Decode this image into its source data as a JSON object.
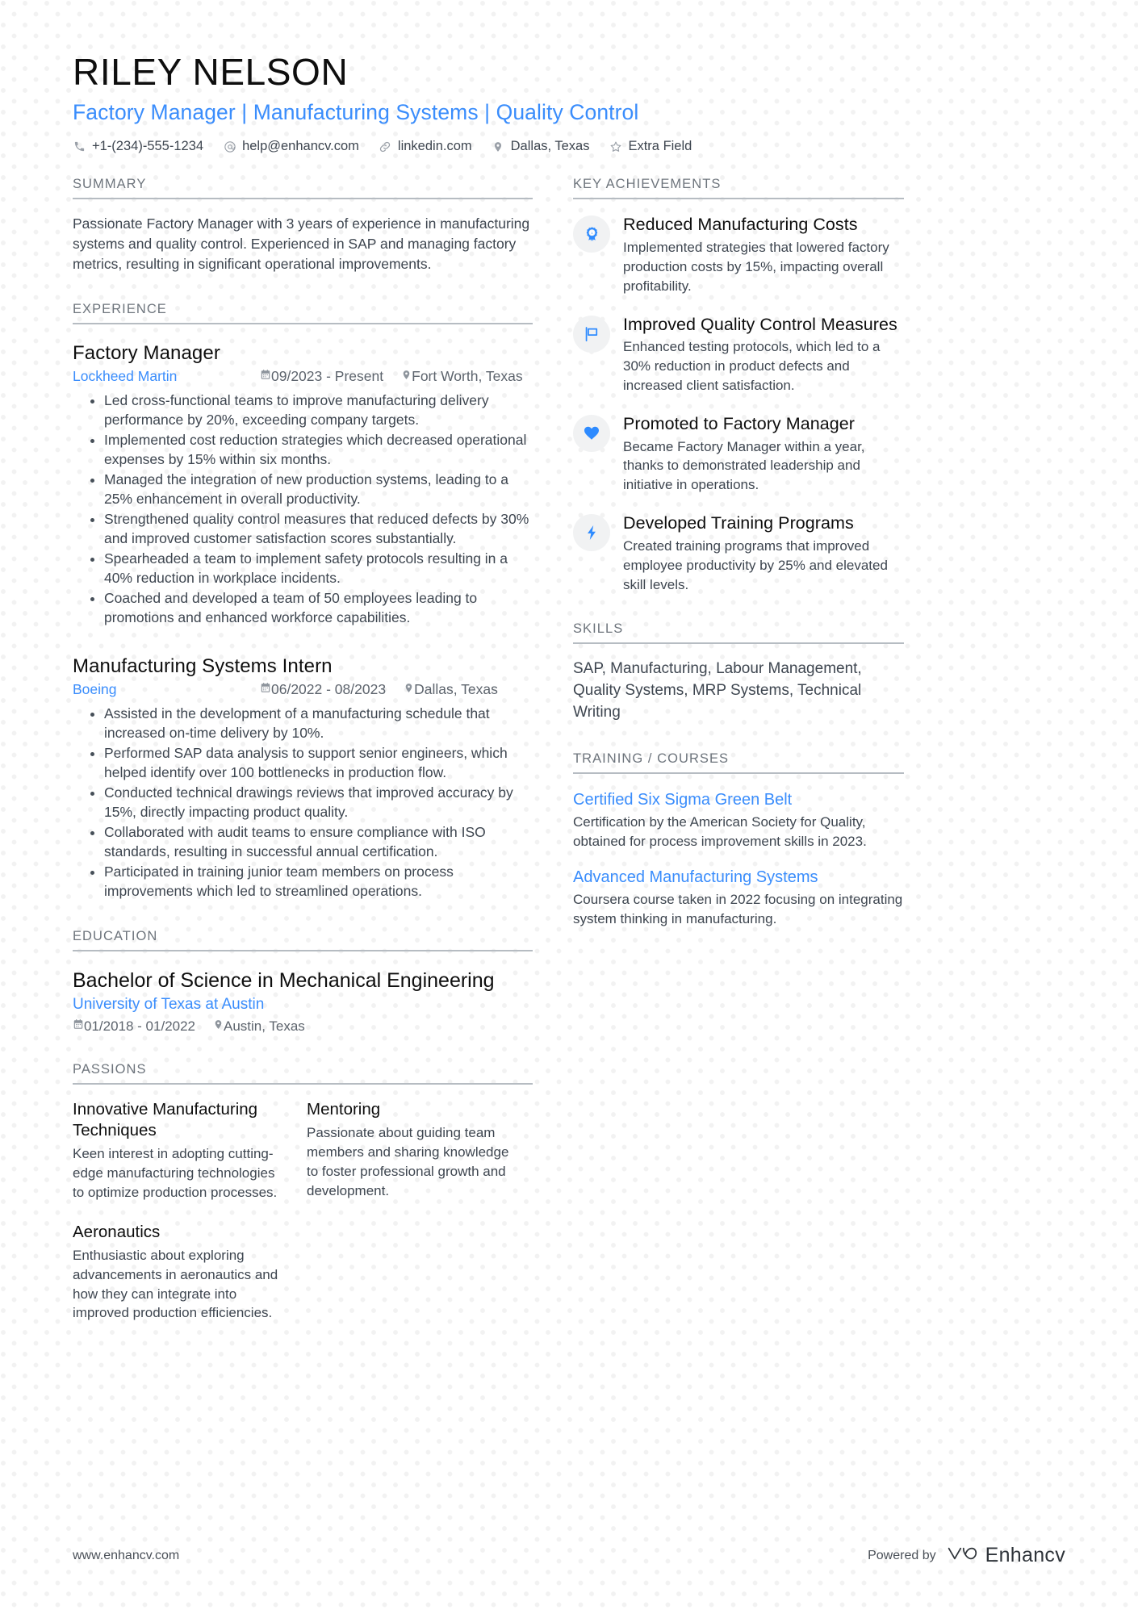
{
  "header": {
    "name": "RILEY NELSON",
    "headline": "Factory Manager | Manufacturing Systems | Quality Control",
    "contact": [
      {
        "icon": "phone-icon",
        "text": "+1-(234)-555-1234"
      },
      {
        "icon": "email-icon",
        "text": "help@enhancv.com"
      },
      {
        "icon": "link-icon",
        "text": "linkedin.com"
      },
      {
        "icon": "location-pin-icon",
        "text": "Dallas, Texas"
      },
      {
        "icon": "star-icon",
        "text": "Extra Field"
      }
    ]
  },
  "summary": {
    "title": "SUMMARY",
    "text": "Passionate Factory Manager with 3 years of experience in manufacturing systems and quality control. Experienced in SAP and managing factory metrics, resulting in significant operational improvements."
  },
  "experience": {
    "title": "EXPERIENCE",
    "jobs": [
      {
        "position": "Factory Manager",
        "company": "Lockheed Martin",
        "dates": "09/2023 - Present",
        "location": "Fort Worth, Texas",
        "bullets": [
          "Led cross-functional teams to improve manufacturing delivery performance by 20%, exceeding company targets.",
          "Implemented cost reduction strategies which decreased operational expenses by 15% within six months.",
          "Managed the integration of new production systems, leading to a 25% enhancement in overall productivity.",
          "Strengthened quality control measures that reduced defects by 30% and improved customer satisfaction scores substantially.",
          "Spearheaded a team to implement safety protocols resulting in a 40% reduction in workplace incidents.",
          "Coached and developed a team of 50 employees leading to promotions and enhanced workforce capabilities."
        ]
      },
      {
        "position": "Manufacturing Systems Intern",
        "company": "Boeing",
        "dates": "06/2022 - 08/2023",
        "location": "Dallas, Texas",
        "bullets": [
          "Assisted in the development of a manufacturing schedule that increased on-time delivery by 10%.",
          "Performed SAP data analysis to support senior engineers, which helped identify over 100 bottlenecks in production flow.",
          "Conducted technical drawings reviews that improved accuracy by 15%, directly impacting product quality.",
          "Collaborated with audit teams to ensure compliance with ISO standards, resulting in successful annual certification.",
          "Participated in training junior team members on process improvements which led to streamlined operations."
        ]
      }
    ]
  },
  "education": {
    "title": "EDUCATION",
    "entries": [
      {
        "degree": "Bachelor of Science in Mechanical Engineering",
        "school": "University of Texas at Austin",
        "dates": "01/2018 - 01/2022",
        "location": "Austin, Texas"
      }
    ]
  },
  "passions": {
    "title": "PASSIONS",
    "column_one": [
      {
        "name": "Innovative Manufacturing Techniques",
        "text": "Keen interest in adopting cutting-edge manufacturing technologies to optimize production processes."
      },
      {
        "name": "Aeronautics",
        "text": "Enthusiastic about exploring advancements in aeronautics and how they can integrate into improved production efficiencies."
      }
    ],
    "column_two": [
      {
        "name": "Mentoring",
        "text": "Passionate about guiding team members and sharing knowledge to foster professional growth and development."
      }
    ]
  },
  "achievements": {
    "title": "KEY ACHIEVEMENTS",
    "items": [
      {
        "icon": "award-medal-icon",
        "name": "Reduced Manufacturing Costs",
        "text": "Implemented strategies that lowered factory production costs by 15%, impacting overall profitability."
      },
      {
        "icon": "flag-icon",
        "name": "Improved Quality Control Measures",
        "text": "Enhanced testing protocols, which led to a 30% reduction in product defects and increased client satisfaction."
      },
      {
        "icon": "heart-icon",
        "name": "Promoted to Factory Manager",
        "text": "Became Factory Manager within a year, thanks to demonstrated leadership and initiative in operations."
      },
      {
        "icon": "lightning-bolt-icon",
        "name": "Developed Training Programs",
        "text": "Created training programs that improved employee productivity by 25% and elevated skill levels."
      }
    ]
  },
  "skills": {
    "title": "SKILLS",
    "text": "SAP, Manufacturing, Labour Management, Quality Systems, MRP Systems, Technical Writing"
  },
  "training": {
    "title": "TRAINING / COURSES",
    "courses": [
      {
        "name": "Certified Six Sigma Green Belt",
        "text": "Certification by the American Society for Quality, obtained for process improvement skills in 2023."
      },
      {
        "name": "Advanced Manufacturing Systems",
        "text": "Coursera course taken in 2022 focusing on integrating system thinking in manufacturing."
      }
    ]
  },
  "footer": {
    "url": "www.enhancv.com",
    "powered_by_label": "Powered by",
    "brand_name": "Enhancv"
  },
  "colors": {
    "accent": "#3a8dfc",
    "icon_accent": "#2e8bff",
    "text": "#3e4650",
    "heading": "#6d747c",
    "badge_bg": "#f1f2f3"
  }
}
